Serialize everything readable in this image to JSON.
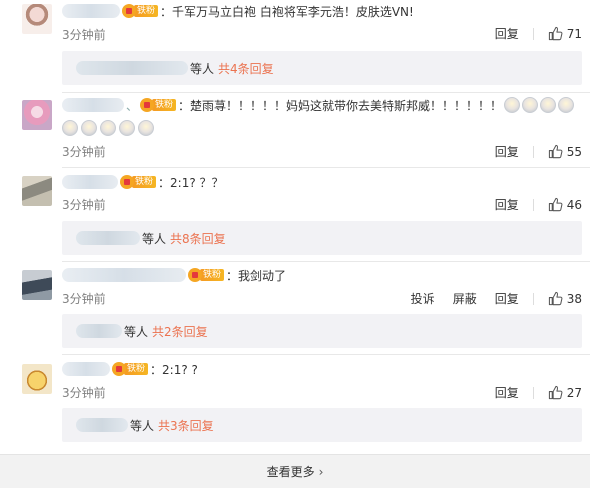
{
  "comments": [
    {
      "badge": "铁粉",
      "text": "：千军万马立白袍 白袍将军李元浩！皮肤选VN!",
      "time": "3分钟前",
      "reply_label": "回复",
      "likes": "71",
      "replies": {
        "suffix": "等人",
        "count_text": "共4条回复"
      }
    },
    {
      "badge": "铁粉",
      "text": "：楚雨荨！！！！！妈妈这就带你去美特斯邦威！！！！！！",
      "time": "3分钟前",
      "reply_label": "回复",
      "likes": "55"
    },
    {
      "badge": "铁粉",
      "text": "：2:1? ？？",
      "time": "3分钟前",
      "reply_label": "回复",
      "likes": "46",
      "replies": {
        "suffix": "等人",
        "count_text": "共8条回复"
      }
    },
    {
      "badge": "铁粉",
      "text": "：我剑动了",
      "time": "3分钟前",
      "report_label": "投诉",
      "block_label": "屏蔽",
      "reply_label": "回复",
      "likes": "38",
      "replies": {
        "suffix": "等人",
        "count_text": "共2条回复"
      }
    },
    {
      "badge": "铁粉",
      "text": "：2:1? ?",
      "time": "3分钟前",
      "reply_label": "回复",
      "likes": "27",
      "replies": {
        "suffix": "等人",
        "count_text": "共3条回复"
      }
    }
  ],
  "view_more": "查看更多",
  "icons": {
    "like": "thumbs-up-icon",
    "view_more_arrow": "chevron-right-icon",
    "badge": "crown-icon",
    "emoji": "crying-face-icon"
  },
  "colors": {
    "link": "#eb7350",
    "badge": "#f5a623",
    "reply_bg": "#f2f2f5",
    "time": "#808080"
  }
}
